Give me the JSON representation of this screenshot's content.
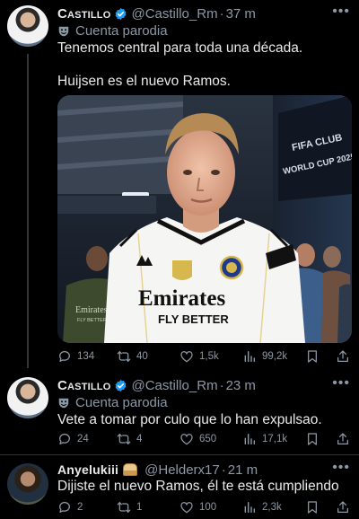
{
  "tweets": [
    {
      "name": "Castillo",
      "handle": "@Castillo_Rm",
      "time": "37 m",
      "parody_label": "Cuenta parodia",
      "text_lines": [
        "Tenemos central para toda una década.",
        "Huijsen es el nuevo Ramos."
      ],
      "media": {
        "banner_text_1": "FIFA CLUB",
        "banner_text_2": "WORLD CUP 2025",
        "shirt_sponsor_1": "Emirates",
        "shirt_sponsor_2": "FLY BETTER",
        "bg_shirt_1": "Emirates",
        "bg_shirt_2": "FLY BETTER"
      },
      "stats": {
        "replies": "134",
        "retweets": "40",
        "likes": "1,5k",
        "views": "99,2k"
      }
    },
    {
      "name": "Castillo",
      "handle": "@Castillo_Rm",
      "time": "23 m",
      "parody_label": "Cuenta parodia",
      "text_lines": [
        "Vete a tomar por culo que lo han expulsao."
      ],
      "stats": {
        "replies": "24",
        "retweets": "4",
        "likes": "650",
        "views": "17,1k"
      }
    },
    {
      "name": "Anyelukiii",
      "handle": "@Helderx17",
      "time": "21 m",
      "text_lines": [
        "Dijiste el nuevo Ramos, él te está cumpliendo"
      ],
      "stats": {
        "replies": "2",
        "retweets": "1",
        "likes": "100",
        "views": "2,3k"
      }
    }
  ],
  "icons": {
    "more": "more-icon",
    "verified": "verified-badge-icon",
    "parody": "parody-mask-icon",
    "reply": "reply-icon",
    "retweet": "retweet-icon",
    "like": "heart-icon",
    "views": "views-icon",
    "bookmark": "bookmark-icon",
    "share": "share-icon"
  },
  "colors": {
    "background": "#000000",
    "text": "#e7e9ea",
    "muted": "#8b98a5",
    "verified": "#1d9bf0",
    "divider": "#2f3336"
  }
}
